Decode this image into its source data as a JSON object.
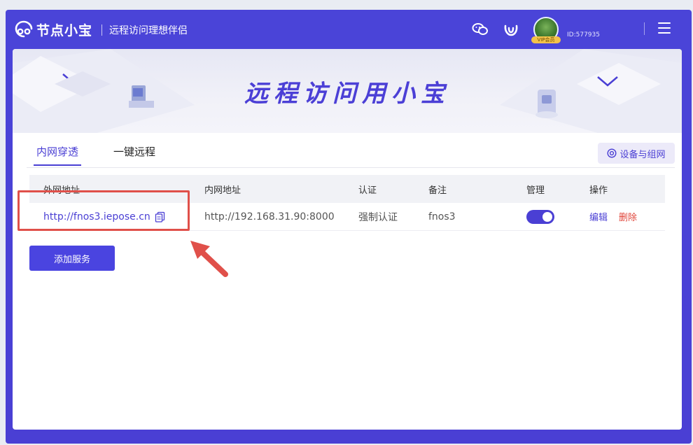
{
  "header": {
    "app_name": "节点小宝",
    "subtitle": "远程访问理想伴侣",
    "user_id": "ID:577935",
    "vip_label": "VIP会员",
    "icons": [
      "wechat-icon",
      "weibo-icon",
      "menu-icon"
    ]
  },
  "banner": {
    "title": "远程访问用小宝"
  },
  "tabs": [
    {
      "label": "内网穿透",
      "active": true
    },
    {
      "label": "一键远程",
      "active": false
    }
  ],
  "group_button": {
    "label": "设备与组网"
  },
  "table": {
    "columns": [
      "外网地址",
      "内网地址",
      "认证",
      "备注",
      "管理",
      "操作"
    ],
    "rows": [
      {
        "external": "http://fnos3.iepose.cn",
        "internal": "http://192.168.31.90:8000",
        "auth": "强制认证",
        "note": "fnos3",
        "enabled": true,
        "edit": "编辑",
        "delete": "删除"
      }
    ]
  },
  "add_button": {
    "label": "添加服务"
  },
  "colors": {
    "accent": "#4a3fd4",
    "danger": "#e0453a",
    "annotation": "#e0504a"
  }
}
